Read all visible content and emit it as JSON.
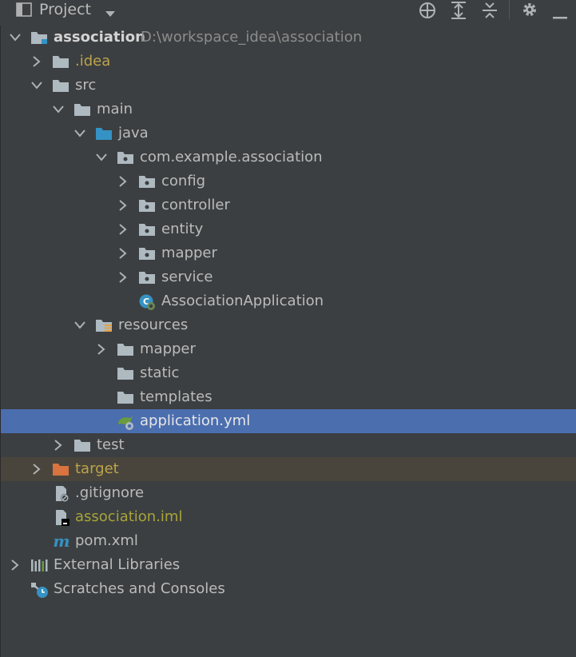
{
  "toolbar": {
    "view_label": "Project",
    "icons": [
      "window-icon",
      "dropdown-arrow-icon",
      "locate-icon",
      "expand-all-icon",
      "collapse-all-icon",
      "settings-icon",
      "hide-icon"
    ]
  },
  "tree": {
    "root": {
      "label": "association",
      "path": "D:\\workspace_idea\\association"
    },
    "idea": ".idea",
    "src": "src",
    "main": "main",
    "java": "java",
    "package": "com.example.association",
    "config": "config",
    "controller": "controller",
    "entity": "entity",
    "mapper": "mapper",
    "service": "service",
    "app_class": "AssociationApplication",
    "resources": "resources",
    "res_mapper": "mapper",
    "static": "static",
    "templates": "templates",
    "app_yml": "application.yml",
    "test": "test",
    "target": "target",
    "gitignore": ".gitignore",
    "iml": "association.iml",
    "pom": "pom.xml",
    "ext_libs": "External Libraries",
    "scratches": "Scratches and Consoles"
  },
  "colors": {
    "background": "#3c3f41",
    "selection": "#4b6eaf",
    "excluded_row": "#49453c",
    "folder": "#aeb9c0",
    "source_folder": "#3592c4",
    "excluded_folder": "#d9733f",
    "ignored_text": "#bca44b"
  }
}
